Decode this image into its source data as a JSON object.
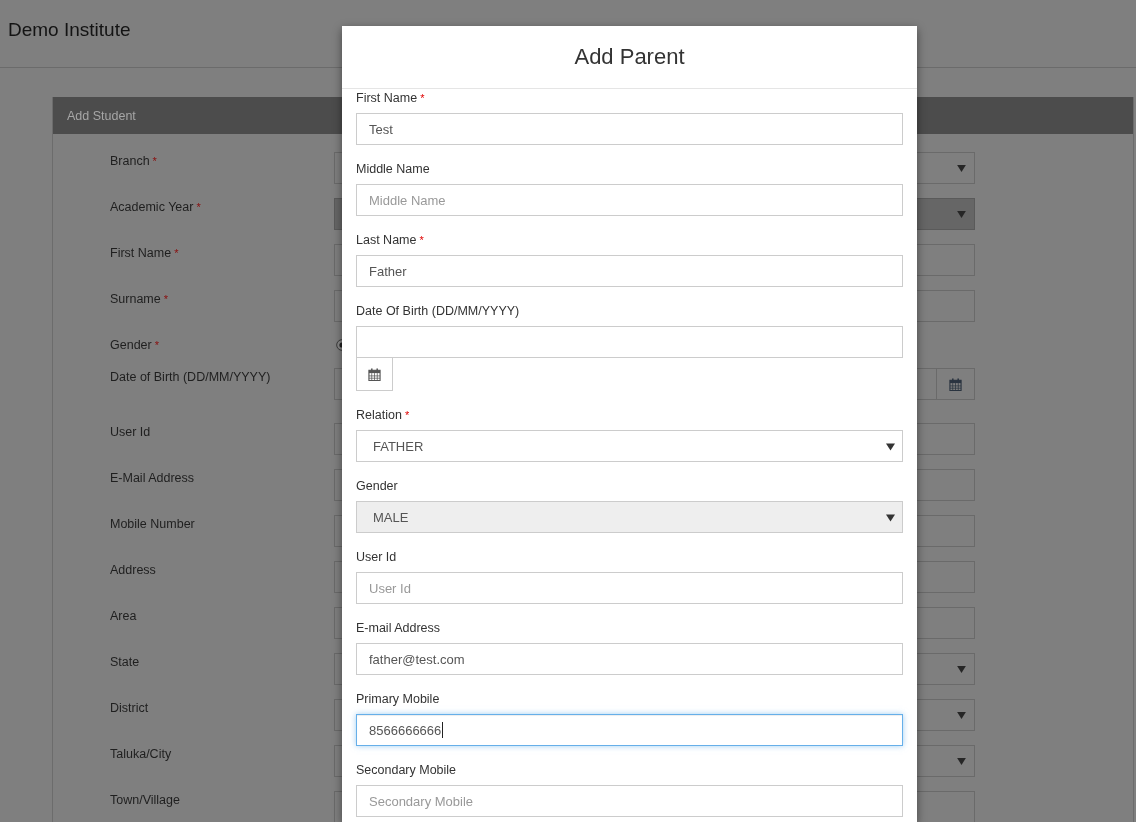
{
  "page": {
    "title": "Demo Institute",
    "panel": {
      "title": "Add Student",
      "rows": [
        {
          "label": "Branch",
          "required_mark": "*",
          "kind": "select",
          "disabled": false
        },
        {
          "label": "Academic Year",
          "required_mark": "*",
          "kind": "select",
          "disabled": true
        },
        {
          "label": "First Name",
          "required_mark": "*",
          "kind": "text",
          "disabled": false
        },
        {
          "label": "Surname",
          "required_mark": "*",
          "kind": "text",
          "disabled": false
        },
        {
          "label": "Gender",
          "required_mark": "*",
          "kind": "radio",
          "selected": true,
          "disabled": false
        },
        {
          "label": "Date of Birth (DD/MM/YYYY)",
          "kind": "date",
          "disabled": false
        },
        {
          "label": "User Id",
          "kind": "text",
          "disabled": false
        },
        {
          "label": "E-Mail Address",
          "kind": "text",
          "disabled": false
        },
        {
          "label": "Mobile Number",
          "kind": "text",
          "disabled": false
        },
        {
          "label": "Address",
          "kind": "text",
          "disabled": false
        },
        {
          "label": "Area",
          "kind": "text",
          "disabled": false
        },
        {
          "label": "State",
          "kind": "select",
          "disabled": false
        },
        {
          "label": "District",
          "kind": "select",
          "disabled": false
        },
        {
          "label": "Taluka/City",
          "kind": "select",
          "disabled": false
        },
        {
          "label": "Town/Village",
          "kind": "text",
          "disabled": false
        }
      ]
    }
  },
  "modal": {
    "title": "Add Parent",
    "fields": [
      {
        "label": "First Name",
        "required_mark": "*",
        "kind": "text",
        "value": "Test",
        "disabled": false,
        "focused": false
      },
      {
        "label": "Middle Name",
        "kind": "text",
        "placeholder": "Middle Name",
        "disabled": false,
        "focused": false
      },
      {
        "label": "Last Name",
        "required_mark": "*",
        "kind": "text",
        "value": "Father",
        "disabled": false,
        "focused": false
      },
      {
        "label": "Date Of Birth (DD/MM/YYYY)",
        "kind": "date",
        "disabled": false,
        "focused": false
      },
      {
        "label": "Relation",
        "required_mark": "*",
        "kind": "select",
        "value": "FATHER",
        "disabled": false,
        "focused": false
      },
      {
        "label": "Gender",
        "kind": "select",
        "value": "MALE",
        "disabled": true,
        "focused": false
      },
      {
        "label": "User Id",
        "kind": "text",
        "placeholder": "User Id",
        "disabled": false,
        "focused": false
      },
      {
        "label": "E-mail Address",
        "kind": "text",
        "value": "father@test.com",
        "disabled": false,
        "focused": false
      },
      {
        "label": "Primary Mobile",
        "kind": "text",
        "value": "8566666666",
        "disabled": false,
        "focused": true
      },
      {
        "label": "Secondary Mobile",
        "kind": "text",
        "placeholder": "Secondary Mobile",
        "disabled": false,
        "focused": false
      }
    ]
  }
}
